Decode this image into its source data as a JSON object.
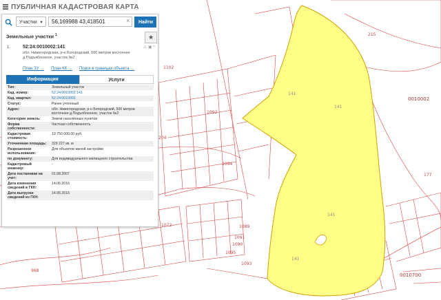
{
  "app": {
    "title": "ПУБЛИЧНАЯ КАДАСТРОВАЯ КАРТА"
  },
  "search": {
    "category": "Участки",
    "query": "56,169988 43,418501",
    "button_label": "Найти"
  },
  "section": {
    "title": "Земельные участки",
    "count": "1"
  },
  "result": {
    "index": "1.",
    "cad_number": "52:24:0010002:141",
    "address": "обл. Нижегородская, р-н Богородский, 500 метров восточнее д.Подъяблонное, участок №2",
    "links": [
      "План ЗУ →",
      "План КК →",
      "Поиск в границах объекта →"
    ]
  },
  "tabs": [
    "Информация",
    "Услуги"
  ],
  "info_rows": [
    {
      "k": "Тип:",
      "v": "Земельный участок"
    },
    {
      "k": "Кад. номер:",
      "v": "52:24:0010002:141",
      "link": true
    },
    {
      "k": "Кад. квартал:",
      "v": "52:24:0010002",
      "link": true
    },
    {
      "k": "Статус:",
      "v": "Ранее учтенный"
    },
    {
      "k": "Адрес:",
      "v": "обл. Нижегородская, р-н Богородский, 500 метров восточнее д.Подъяблонное, участок №2"
    },
    {
      "k": "Категория земель:",
      "v": "Земли населённых пунктов"
    },
    {
      "k": "Форма собственности:",
      "v": "Частная собственность"
    },
    {
      "k": "Кадастровая стоимость:",
      "v": "19 750 000,00 руб."
    },
    {
      "k": "Уточненная площадь:",
      "v": "329 227 кв. м"
    },
    {
      "k": "Разрешенное использование:",
      "v": "Для объектов жилой застройки"
    },
    {
      "k": "по документу:",
      "v": "Для индивидуального жилищного строительства"
    },
    {
      "k": "Кадастровый инженер:",
      "v": "-"
    },
    {
      "k": "Дата постановки на учет:",
      "v": "01.08.2007"
    },
    {
      "k": "Дата изменения сведений в ГКН:",
      "v": "14.06.2016"
    },
    {
      "k": "Дата выгрузки сведений из ГКН:",
      "v": "14.06.2016"
    }
  ],
  "map_labels": [
    "215",
    "0010002",
    "141",
    "141",
    "141",
    "141",
    "177",
    "0010700",
    "204",
    "968",
    "1102",
    "1092",
    "1094",
    "1072",
    "1090",
    "1091",
    "1095",
    "1093",
    "1089"
  ],
  "colors": {
    "accent": "#1d73b6",
    "parcel_fill": "#ffff88",
    "parcel_line": "#d0a000",
    "map_lines": "#e04040"
  }
}
